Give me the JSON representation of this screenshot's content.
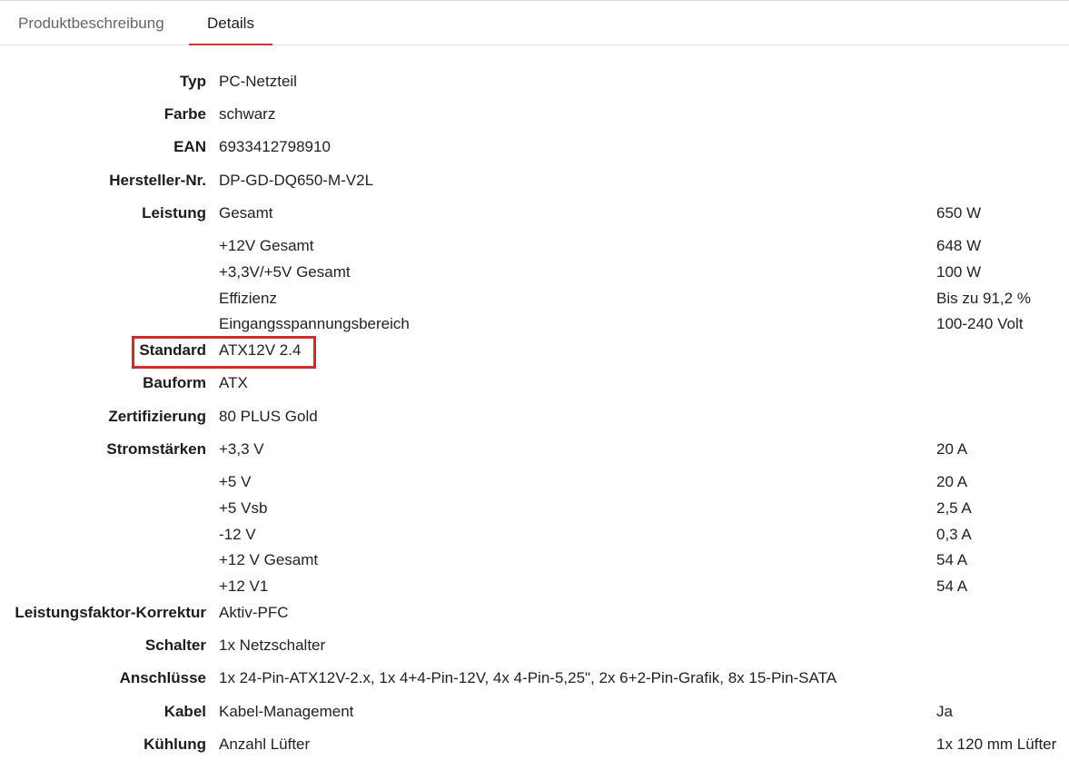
{
  "tabs": [
    {
      "label": "Produktbeschreibung",
      "active": false
    },
    {
      "label": "Details",
      "active": true
    }
  ],
  "accent_color": "#c0392b",
  "highlight_color": "#d7262e",
  "details": {
    "typ": {
      "label": "Typ",
      "value": "PC-Netzteil"
    },
    "farbe": {
      "label": "Farbe",
      "value": "schwarz"
    },
    "ean": {
      "label": "EAN",
      "value": "6933412798910"
    },
    "hersteller": {
      "label": "Hersteller-Nr.",
      "value": "DP-GD-DQ650-M-V2L"
    },
    "leistung": {
      "label": "Leistung",
      "rows": [
        {
          "key": "Gesamt",
          "value": "650 W"
        },
        {
          "key": "+12V Gesamt",
          "value": "648 W"
        },
        {
          "key": "+3,3V/+5V Gesamt",
          "value": "100 W"
        },
        {
          "key": "Effizienz",
          "value": "Bis zu 91,2 %"
        },
        {
          "key": "Eingangsspannungsbereich",
          "value": "100-240 Volt"
        }
      ]
    },
    "standard": {
      "label": "Standard",
      "value": "ATX12V 2.4"
    },
    "bauform": {
      "label": "Bauform",
      "value": "ATX"
    },
    "zertifizierung": {
      "label": "Zertifizierung",
      "value": "80 PLUS Gold"
    },
    "stromstaerken": {
      "label": "Stromstärken",
      "rows": [
        {
          "key": "+3,3 V",
          "value": "20 A"
        },
        {
          "key": "+5 V",
          "value": "20 A"
        },
        {
          "key": "+5 Vsb",
          "value": "2,5 A"
        },
        {
          "key": "-12 V",
          "value": "0,3 A"
        },
        {
          "key": "+12 V Gesamt",
          "value": "54 A"
        },
        {
          "key": "+12 V1",
          "value": "54 A"
        }
      ]
    },
    "pfc": {
      "label": "Leistungsfaktor-Korrektur",
      "value": "Aktiv-PFC"
    },
    "schalter": {
      "label": "Schalter",
      "value": "1x Netzschalter"
    },
    "anschluesse": {
      "label": "Anschlüsse",
      "value": "1x 24-Pin-ATX12V-2.x, 1x 4+4-Pin-12V, 4x 4-Pin-5,25\", 2x 6+2-Pin-Grafik, 8x 15-Pin-SATA"
    },
    "kabel": {
      "label": "Kabel",
      "key": "Kabel-Management",
      "value": "Ja"
    },
    "kuehlung": {
      "label": "Kühlung",
      "key": "Anzahl Lüfter",
      "value": "1x 120 mm Lüfter"
    }
  }
}
